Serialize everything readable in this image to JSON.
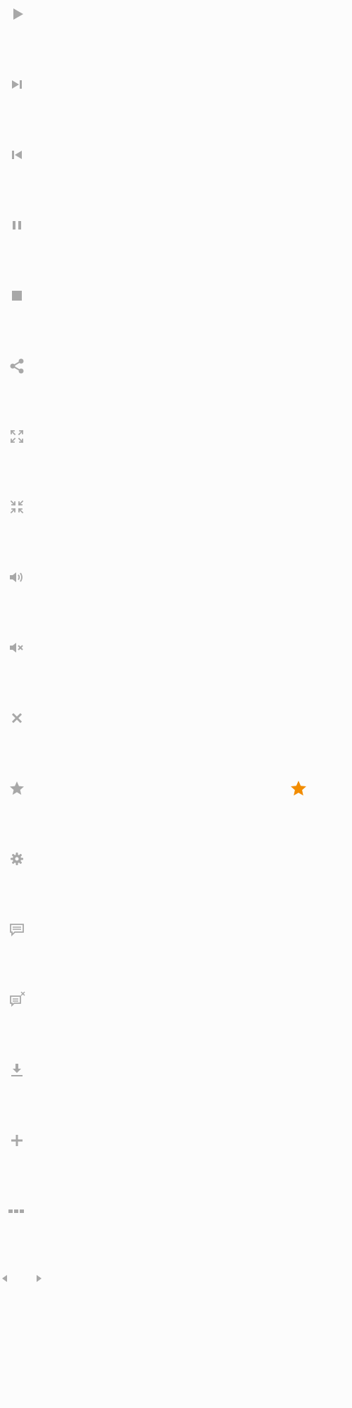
{
  "icons": [
    {
      "name": "play-icon"
    },
    {
      "name": "skip-next-icon"
    },
    {
      "name": "skip-previous-icon"
    },
    {
      "name": "pause-icon"
    },
    {
      "name": "stop-icon"
    },
    {
      "name": "share-icon"
    },
    {
      "name": "fullscreen-icon"
    },
    {
      "name": "exit-fullscreen-icon"
    },
    {
      "name": "volume-icon"
    },
    {
      "name": "mute-icon"
    },
    {
      "name": "close-icon"
    },
    {
      "name": "star-icon"
    },
    {
      "name": "gear-icon"
    },
    {
      "name": "captions-icon"
    },
    {
      "name": "captions-off-icon"
    },
    {
      "name": "download-icon"
    },
    {
      "name": "plus-icon"
    },
    {
      "name": "more-icon"
    }
  ],
  "colors": {
    "icon_grey": "#a8a8a8",
    "accent_orange": "#f28c00",
    "background": "#fcfcfc"
  },
  "scroll_arrows": [
    {
      "name": "scroll-left-arrow-icon"
    },
    {
      "name": "scroll-right-arrow-icon"
    }
  ]
}
